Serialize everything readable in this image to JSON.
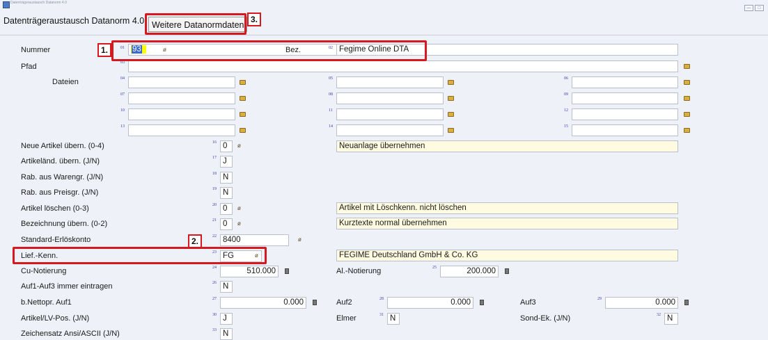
{
  "window": {
    "title": "Datenträgeraustausch Datanorm 4.0",
    "tab_main": "Datenträgeraustausch Datanorm 4.0",
    "tab_active": "Weitere Datanormdaten",
    "min_label": "—",
    "max_label": "□"
  },
  "annotations": [
    "1.",
    "2.",
    "3."
  ],
  "nummer": {
    "label": "Nummer",
    "fnum": "01",
    "value": "93"
  },
  "bez": {
    "label": "Bez.",
    "fnum": "02",
    "value": "Fegime Online DTA"
  },
  "pfad": {
    "label": "Pfad",
    "fnum": "03",
    "value": ""
  },
  "dateien": {
    "label": "Dateien",
    "fields": [
      {
        "fnum": "04",
        "value": ""
      },
      {
        "fnum": "05",
        "value": ""
      },
      {
        "fnum": "06",
        "value": ""
      },
      {
        "fnum": "07",
        "value": ""
      },
      {
        "fnum": "08",
        "value": ""
      },
      {
        "fnum": "09",
        "value": ""
      },
      {
        "fnum": "10",
        "value": ""
      },
      {
        "fnum": "11",
        "value": ""
      },
      {
        "fnum": "12",
        "value": ""
      },
      {
        "fnum": "13",
        "value": ""
      },
      {
        "fnum": "14",
        "value": ""
      },
      {
        "fnum": "15",
        "value": ""
      }
    ]
  },
  "rows": {
    "neue_artikel": {
      "label": "Neue Artikel übern. (0-4)",
      "fnum": "16",
      "value": "0",
      "desc": "Neuanlage übernehmen"
    },
    "artikelaend": {
      "label": "Artikeländ. übern.  (J/N)",
      "fnum": "17",
      "value": "J"
    },
    "rab_waren": {
      "label": "Rab. aus Warengr.  (J/N)",
      "fnum": "18",
      "value": "N"
    },
    "rab_preis": {
      "label": "Rab. aus Preisgr.   (J/N)",
      "fnum": "19",
      "value": "N"
    },
    "artikel_loeschen": {
      "label": "Artikel löschen    (0-3)",
      "fnum": "20",
      "value": "0",
      "desc": "Artikel mit Löschkenn. nicht löschen"
    },
    "bezeichnung": {
      "label": "Bezeichnung übern.  (0-2)",
      "fnum": "21",
      "value": "0",
      "desc": "Kurztexte normal übernehmen"
    },
    "standard_erloes": {
      "label": "Standard-Erlöskonto",
      "fnum": "22",
      "value": "8400"
    },
    "lief_kenn": {
      "label": "Lief.-Kenn.",
      "fnum": "23",
      "value": "FG",
      "desc": "FEGIME Deutschland GmbH & Co. KG"
    },
    "cu_notierung": {
      "label": "Cu-Notierung",
      "fnum": "24",
      "value": "510.000"
    },
    "al_notierung": {
      "label": "Al.-Notierung",
      "fnum": "25",
      "value": "200.000"
    },
    "auf1_auf3": {
      "label": "Auf1-Auf3 immer eintragen",
      "fnum": "26",
      "value": "N"
    },
    "b_nettopr": {
      "label": "b.Nettopr. Auf1",
      "fnum": "27",
      "value": "0.000"
    },
    "auf2": {
      "label": "Auf2",
      "fnum": "28",
      "value": "0.000"
    },
    "auf3": {
      "label": "Auf3",
      "fnum": "29",
      "value": "0.000"
    },
    "artikel_lv": {
      "label": "Artikel/LV-Pos. (J/N)",
      "fnum": "30",
      "value": "J"
    },
    "elmer": {
      "label": "Elmer",
      "fnum": "31",
      "value": "N"
    },
    "sond_ek": {
      "label": "Sond-Ek. (J/N)",
      "fnum": "32",
      "value": "N"
    },
    "zeichensatz": {
      "label": "Zeichensatz Ansi/ASCII (J/N)",
      "fnum": "33",
      "value": "N"
    }
  }
}
